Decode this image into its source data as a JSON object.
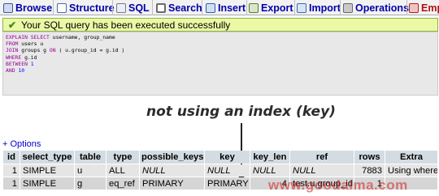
{
  "tabs": [
    {
      "label": "Browse",
      "icon": "browse-icon"
    },
    {
      "label": "Structure",
      "icon": "structure-icon"
    },
    {
      "label": "SQL",
      "icon": "sql-icon"
    },
    {
      "label": "Search",
      "icon": "search-icon"
    },
    {
      "label": "Insert",
      "icon": "insert-icon"
    },
    {
      "label": "Export",
      "icon": "export-icon"
    },
    {
      "label": "Import",
      "icon": "import-icon"
    },
    {
      "label": "Operations",
      "icon": "operations-icon"
    },
    {
      "label": "Emp",
      "icon": "empty-icon"
    }
  ],
  "success_message": "Your SQL query has been executed successfully",
  "sql_lines": [
    [
      "EXPLAIN SELECT",
      "username, group_name"
    ],
    [
      "FROM",
      "users u"
    ],
    [
      "JOIN",
      "groups g",
      "ON",
      "( u.group_id = g.id )"
    ],
    [
      "WHERE",
      "g.id"
    ],
    [
      "BETWEEN",
      "1"
    ],
    [
      "AND",
      "10"
    ]
  ],
  "annotation": "not using an index (key)",
  "options_link": "+ Options",
  "table": {
    "headers": [
      "id",
      "select_type",
      "table",
      "type",
      "possible_keys",
      "key",
      "key_len",
      "ref",
      "rows",
      "Extra"
    ],
    "rows": [
      [
        "1",
        "SIMPLE",
        "u",
        "ALL",
        "NULL",
        "NULL",
        "NULL",
        "NULL",
        "7883",
        "Using where"
      ],
      [
        "1",
        "SIMPLE",
        "g",
        "eq_ref",
        "PRIMARY",
        "PRIMARY",
        "4",
        "test.u.group_id",
        "1",
        ""
      ]
    ]
  },
  "watermark": "www.goodaima.com",
  "colors": {
    "tab_label": "#0000aa",
    "success_bg": "#ebf8a4",
    "header_bg": "#d3dce3",
    "sql_keyword": "#990099",
    "watermark": "#d21e1e"
  }
}
